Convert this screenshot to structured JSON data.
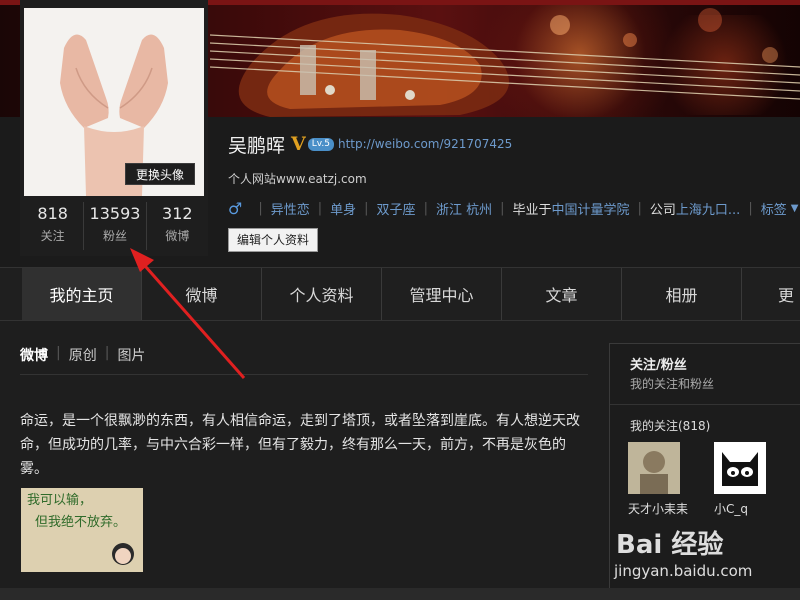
{
  "profile": {
    "name": "吴鹏晖",
    "verified_mark": "V",
    "level": "Lv.5",
    "url": "http://weibo.com/921707425",
    "site": "个人网站www.eatzj.com",
    "avatar_change": "更换头像",
    "edit_profile": "编辑个人资料",
    "tags": {
      "orientation": "异性恋",
      "relationship": "单身",
      "zodiac": "双子座",
      "location": "浙江 杭州",
      "school_prefix": "毕业于",
      "school": "中国计量学院",
      "company_prefix": "公司",
      "company": "上海九口...",
      "tag_menu": "标签"
    }
  },
  "stats": [
    {
      "num": "818",
      "label": "关注"
    },
    {
      "num": "13593",
      "label": "粉丝"
    },
    {
      "num": "312",
      "label": "微博"
    }
  ],
  "nav": [
    "我的主页",
    "微博",
    "个人资料",
    "管理中心",
    "文章",
    "相册",
    "更"
  ],
  "subtabs": [
    "微博",
    "原创",
    "图片"
  ],
  "post": {
    "text": "命运，是一个很飘渺的东西，有人相信命运，走到了塔顶，或者坠落到崖底。有人想逆天改命，但成功的几率，与中六合彩一样，但有了毅力，终有那么一天，前方，不再是灰色的雾。",
    "image_text_1": "我可以输，",
    "image_text_2": "但我绝不放弃。"
  },
  "sidebar": {
    "title": "关注/粉丝",
    "subtitle": "我的关注和粉丝",
    "following_label": "我的关注(818)",
    "following": [
      {
        "name": "天才小耒耒"
      },
      {
        "name": "小C_q"
      }
    ]
  },
  "watermark": {
    "brand": "Bai 经验",
    "url": "jingyan.baidu.com"
  },
  "colors": {
    "link": "#6d9acc",
    "annotation_arrow": "#e02020"
  }
}
